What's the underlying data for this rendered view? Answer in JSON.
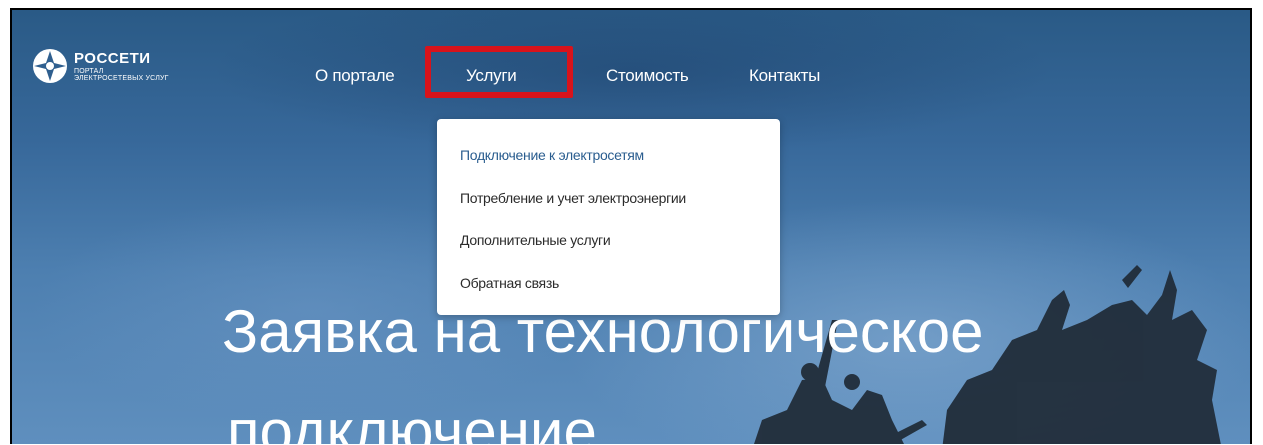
{
  "logo": {
    "title": "РОССЕТИ",
    "subtitle_line1": "ПОРТАЛ",
    "subtitle_line2": "ЭЛЕКТРОСЕТЕВЫХ УСЛУГ"
  },
  "nav": {
    "items": [
      {
        "label": "О портале"
      },
      {
        "label": "Услуги",
        "highlighted": true
      },
      {
        "label": "Стоимость"
      },
      {
        "label": "Контакты"
      }
    ]
  },
  "dropdown": {
    "items": [
      {
        "label": "Подключение к электросетям",
        "active": true
      },
      {
        "label": "Потребление и учет электроэнергии"
      },
      {
        "label": "Дополнительные услуги"
      },
      {
        "label": "Обратная связь"
      }
    ]
  },
  "hero": {
    "line1": "Заявка на технологическое",
    "line2": "подключение"
  },
  "colors": {
    "highlight": "#d8131b",
    "active_link": "#2a5d8f",
    "sky": "#37689a"
  }
}
